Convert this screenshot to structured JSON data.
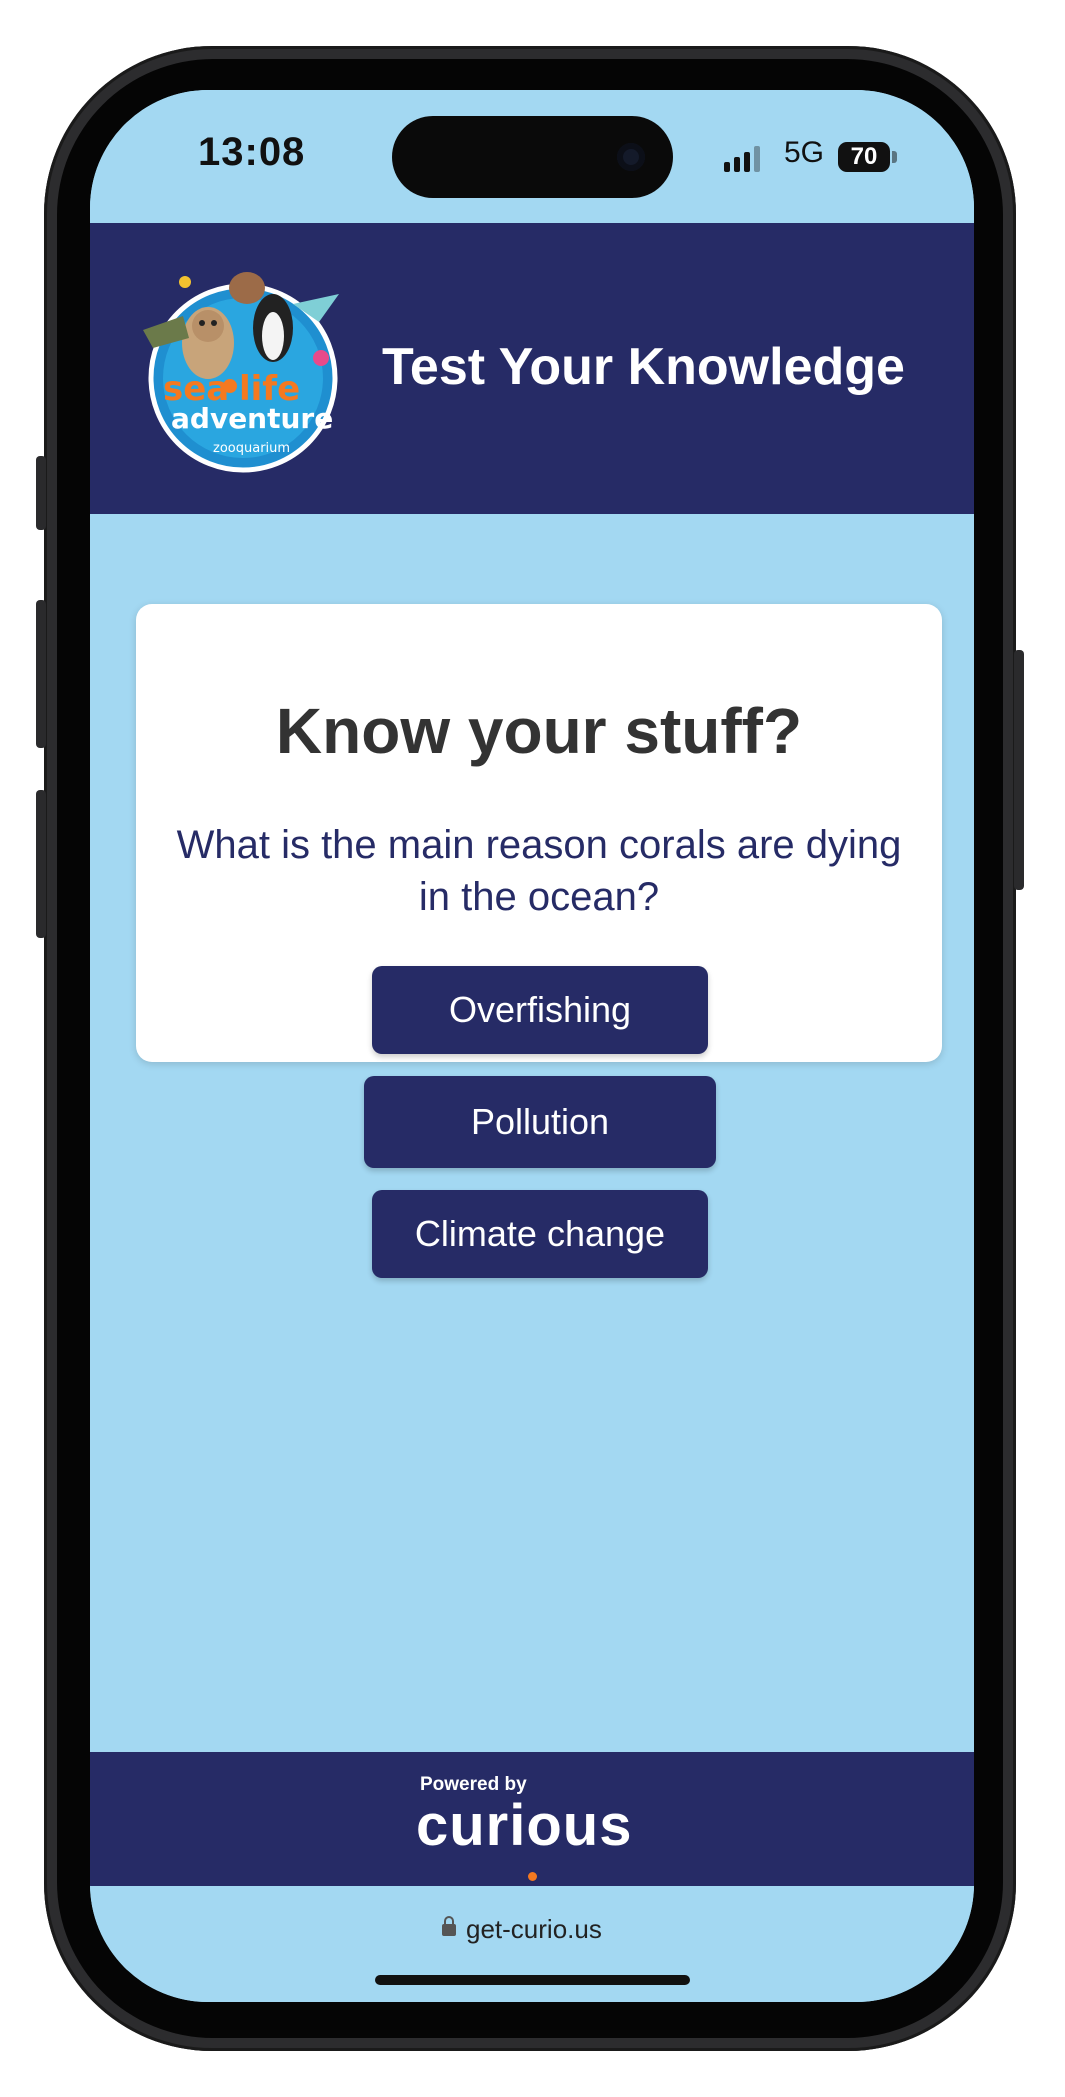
{
  "status_bar": {
    "time": "13:08",
    "network": "5G",
    "battery": "70"
  },
  "header": {
    "title": "Test Your Knowledge",
    "logo_text_line1": "sea",
    "logo_text_line1b": "life",
    "logo_text_line2": "adventure",
    "logo_text_line3": "zooquarium"
  },
  "quiz": {
    "title": "Know your stuff?",
    "question": "What is the main reason corals are dying in the ocean?",
    "answers": [
      "Overfishing",
      "Pollution",
      "Climate change"
    ]
  },
  "footer": {
    "powered_by": "Powered by",
    "brand": "curious"
  },
  "browser": {
    "url": "get-curio.us"
  },
  "colors": {
    "navy": "#262b66",
    "sky": "#a3d8f2",
    "accent_orange": "#f47920"
  }
}
